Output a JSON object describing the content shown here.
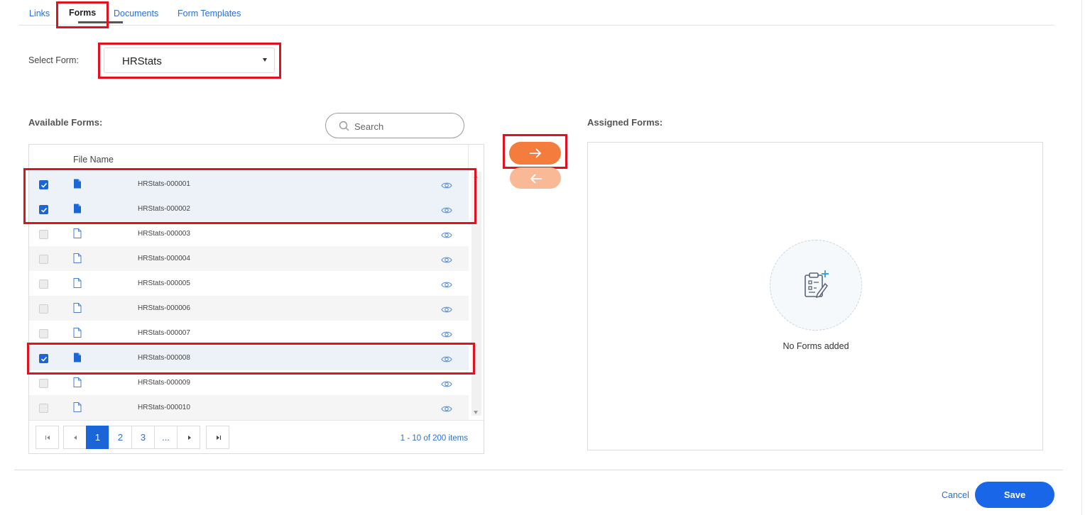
{
  "tabs": [
    {
      "label": "Links",
      "active": false
    },
    {
      "label": "Forms",
      "active": true
    },
    {
      "label": "Documents",
      "active": false
    },
    {
      "label": "Form Templates",
      "active": false
    }
  ],
  "select_form": {
    "label": "Select Form:",
    "value": "HRStats"
  },
  "available": {
    "title": "Available Forms:",
    "search_placeholder": "Search",
    "column_header": "File Name",
    "rows": [
      {
        "name": "HRStats-000001",
        "checked": true
      },
      {
        "name": "HRStats-000002",
        "checked": true
      },
      {
        "name": "HRStats-000003",
        "checked": false
      },
      {
        "name": "HRStats-000004",
        "checked": false
      },
      {
        "name": "HRStats-000005",
        "checked": false
      },
      {
        "name": "HRStats-000006",
        "checked": false
      },
      {
        "name": "HRStats-000007",
        "checked": false
      },
      {
        "name": "HRStats-000008",
        "checked": true
      },
      {
        "name": "HRStats-000009",
        "checked": false
      },
      {
        "name": "HRStats-000010",
        "checked": false
      }
    ],
    "pager": {
      "pages": [
        "1",
        "2",
        "3",
        "..."
      ],
      "current": "1",
      "info": "1 - 10 of 200 items"
    }
  },
  "assigned": {
    "title": "Assigned Forms:",
    "empty_text": "No Forms added"
  },
  "footer": {
    "cancel": "Cancel",
    "save": "Save"
  },
  "colors": {
    "accent_orange": "#f47c3c",
    "accent_orange_disabled": "#f9b996",
    "primary_blue": "#1a66e8",
    "highlight_red": "#e0121f"
  },
  "icons": [
    "file-icon",
    "eye-icon",
    "search-icon",
    "arrow-right-icon",
    "arrow-left-icon",
    "form-add-icon"
  ]
}
